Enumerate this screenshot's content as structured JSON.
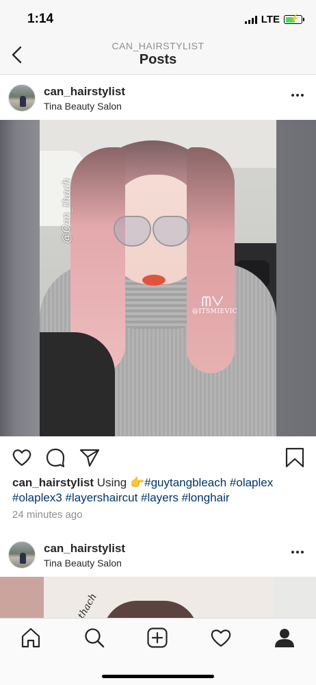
{
  "status_bar": {
    "time": "1:14",
    "network": "LTE",
    "battery_level": 0.6,
    "battery_charging": true
  },
  "header": {
    "subtitle": "CAN_HAIRSTYLIST",
    "title": "Posts",
    "back_icon": "chevron-left-icon"
  },
  "posts": [
    {
      "username": "can_hairstylist",
      "location": "Tina Beauty Salon",
      "image_watermarks": [
        "@Can_thach",
        "@ITSMIEVIC"
      ],
      "caption_user": "can_hairstylist",
      "caption_text": " Using 👉",
      "caption_tags": "#guytangbleach #olaplex #olaplex3 #layershaircut #layers #longhair",
      "timestamp": "24 minutes ago",
      "actions": [
        "heart-icon",
        "comment-icon",
        "share-icon",
        "bookmark-icon"
      ]
    },
    {
      "username": "can_hairstylist",
      "location": "Tina Beauty Salon",
      "image_watermark": "thach"
    }
  ],
  "tab_bar": {
    "items": [
      "home-icon",
      "search-icon",
      "new-post-icon",
      "activity-icon",
      "profile-icon"
    ]
  },
  "colors": {
    "hashtag": "#003569",
    "muted": "#8e8e8e",
    "battery": "#4cd964"
  }
}
